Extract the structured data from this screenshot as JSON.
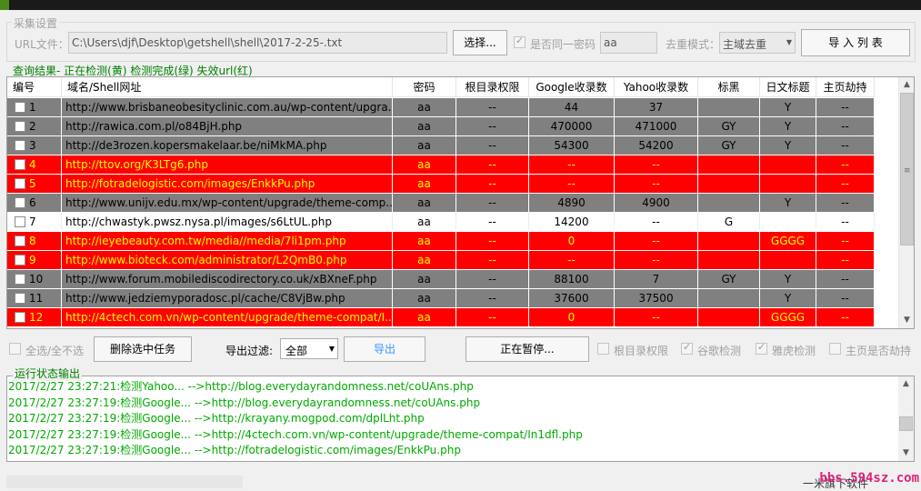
{
  "settings": {
    "group_title": "采集设置",
    "url_file_label": "URL文件：",
    "url_file_value": "C:\\Users\\djf\\Desktop\\getshell\\shell\\2017-2-25-.txt",
    "browse_button": "选择...",
    "same_password_label": "是否同一密码",
    "same_password_checked": true,
    "password_value": "aa",
    "dedupe_label": "去重模式：",
    "dedupe_value": "主域去重",
    "import_button": "导 入 列 表"
  },
  "results": {
    "label": "查询结果- 正在检测(黄) 检测完成(绿) 失效url(红)",
    "columns": [
      "编号",
      "域名/Shell网址",
      "密码",
      "根目录权限",
      "Google收录数",
      "Yahoo收录数",
      "标黑",
      "日文标题",
      "主页劫持"
    ],
    "rows": [
      {
        "status": "gray",
        "id": "1",
        "url": "http://www.brisbaneobesityclinic.com.au/wp-content/upgra...",
        "pwd": "aa",
        "root": "--",
        "google": "44",
        "yahoo": "37",
        "black": "",
        "jp": "Y",
        "hijack": "--"
      },
      {
        "status": "gray",
        "id": "2",
        "url": "http://rawica.com.pl/o84BjH.php",
        "pwd": "aa",
        "root": "--",
        "google": "470000",
        "yahoo": "471000",
        "black": "GY",
        "jp": "Y",
        "hijack": "--"
      },
      {
        "status": "gray",
        "id": "3",
        "url": "http://de3rozen.kopersmakelaar.be/niMkMA.php",
        "pwd": "aa",
        "root": "--",
        "google": "54300",
        "yahoo": "54200",
        "black": "GY",
        "jp": "Y",
        "hijack": "--"
      },
      {
        "status": "red",
        "id": "4",
        "url": "http://ttov.org/K3LTg6.php",
        "pwd": "aa",
        "root": "--",
        "google": "--",
        "yahoo": "--",
        "black": "",
        "jp": "",
        "hijack": "--"
      },
      {
        "status": "red",
        "id": "5",
        "url": "http://fotradelogistic.com/images/EnkkPu.php",
        "pwd": "aa",
        "root": "--",
        "google": "--",
        "yahoo": "--",
        "black": "",
        "jp": "",
        "hijack": "--"
      },
      {
        "status": "gray",
        "id": "6",
        "url": "http://www.unijv.edu.mx/wp-content/upgrade/theme-comp...",
        "pwd": "aa",
        "root": "--",
        "google": "4890",
        "yahoo": "4900",
        "black": "",
        "jp": "Y",
        "hijack": "--"
      },
      {
        "status": "white",
        "id": "7",
        "url": "http://chwastyk.pwsz.nysa.pl/images/s6LtUL.php",
        "pwd": "aa",
        "root": "--",
        "google": "14200",
        "yahoo": "--",
        "black": "G",
        "jp": "",
        "hijack": "--"
      },
      {
        "status": "red",
        "id": "8",
        "url": "http://ieyebeauty.com.tw/media//media/7li1pm.php",
        "pwd": "aa",
        "root": "--",
        "google": "0",
        "yahoo": "--",
        "black": "",
        "jp": "GGGG",
        "hijack": "--"
      },
      {
        "status": "red",
        "id": "9",
        "url": "http://www.bioteck.com/administrator/L2QmB0.php",
        "pwd": "aa",
        "root": "--",
        "google": "--",
        "yahoo": "--",
        "black": "",
        "jp": "",
        "hijack": "--"
      },
      {
        "status": "gray",
        "id": "10",
        "url": "http://www.forum.mobilediscodirectory.co.uk/xBXneF.php",
        "pwd": "aa",
        "root": "--",
        "google": "88100",
        "yahoo": "7",
        "black": "GY",
        "jp": "Y",
        "hijack": "--"
      },
      {
        "status": "gray",
        "id": "11",
        "url": "http://www.jedziemyporadosc.pl/cache/C8VjBw.php",
        "pwd": "aa",
        "root": "--",
        "google": "37600",
        "yahoo": "37500",
        "black": "",
        "jp": "Y",
        "hijack": "--"
      },
      {
        "status": "red",
        "id": "12",
        "url": "http://4ctech.com.vn/wp-content/upgrade/theme-compat/I...",
        "pwd": "aa",
        "root": "--",
        "google": "0",
        "yahoo": "--",
        "black": "",
        "jp": "GGGG",
        "hijack": "--"
      }
    ]
  },
  "toolbar": {
    "select_all_label": "全选/全不选",
    "delete_selected_button": "删除选中任务",
    "export_filter_label": "导出过滤:",
    "export_filter_value": "全部",
    "export_button": "导出",
    "pause_button": "正在暂停...",
    "opt_root": "根目录权限",
    "opt_google": "谷歌检测",
    "opt_yahoo": "雅虎检测",
    "opt_hijack": "主页是否劫持",
    "opt_root_checked": false,
    "opt_google_checked": true,
    "opt_yahoo_checked": true,
    "opt_hijack_checked": false
  },
  "log": {
    "label": "运行状态输出",
    "lines": [
      "2017/2/27 23:27:21:检测Yahoo... -->http://blog.everydayrandomness.net/coUAns.php",
      "2017/2/27 23:27:19:检测Google... -->http://blog.everydayrandomness.net/coUAns.php",
      "2017/2/27 23:27:19:检测Google... -->http://krayany.mogpod.com/dplLht.php",
      "2017/2/27 23:27:19:检测Google... -->http://4ctech.com.vn/wp-content/upgrade/theme-compat/In1dfl.php",
      "2017/2/27 23:27:19:检测Google... -->http://fotradelogistic.com/images/EnkkPu.php"
    ]
  },
  "footer": {
    "text": "一米旗下软件",
    "watermark": "bbs.594sz.com"
  },
  "colors": {
    "gray_row": "#808080",
    "red_row": "#ff0000",
    "red_text": "#ffff00",
    "log_text": "#00aa00",
    "label_green": "#008000"
  }
}
